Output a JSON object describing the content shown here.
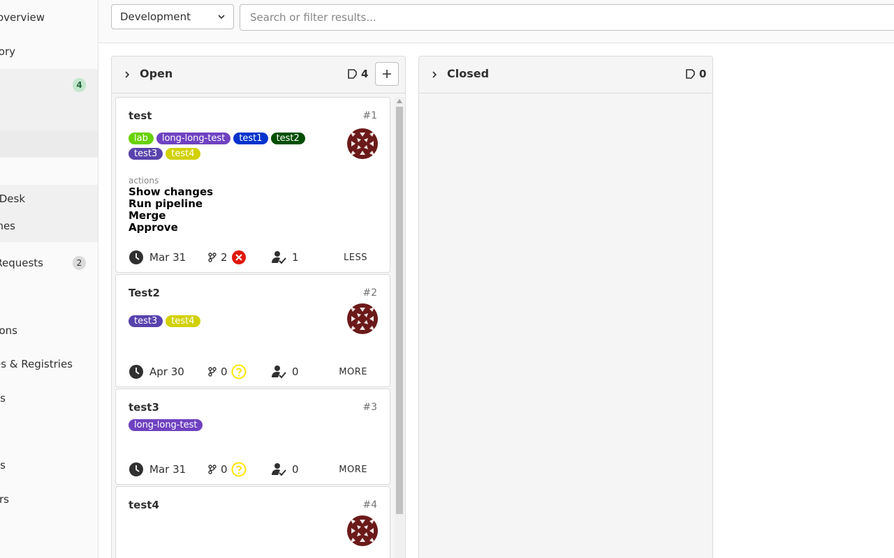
{
  "sidebar": {
    "items": [
      {
        "label": "overview"
      },
      {
        "label": "ory"
      },
      {
        "label": "Desk"
      },
      {
        "label": "nes"
      },
      {
        "label": "Requests"
      },
      {
        "label": "ons"
      },
      {
        "label": "es & Registries"
      },
      {
        "label": "s"
      },
      {
        "label": "s"
      },
      {
        "label": "rs"
      }
    ],
    "issues_count": "4",
    "mr_count": "2"
  },
  "filter": {
    "selected_board": "Development",
    "search_placeholder": "Search or filter results..."
  },
  "lists": {
    "open": {
      "title": "Open",
      "count": "4"
    },
    "closed": {
      "title": "Closed",
      "count": "0"
    }
  },
  "cards": [
    {
      "title": "test",
      "number": "#1",
      "labels": [
        {
          "text": "lab",
          "color": "#69d100"
        },
        {
          "text": "long-long-test",
          "color": "#6f42c1"
        },
        {
          "text": "test1",
          "color": "#0033cc"
        },
        {
          "text": "test2",
          "color": "#004e00"
        },
        {
          "text": "test3",
          "color": "#5843ad"
        },
        {
          "text": "test4",
          "color": "#d1d100"
        }
      ],
      "actions_heading": "actions",
      "actions": [
        "Show changes",
        "Run pipeline",
        "Merge",
        "Approve"
      ],
      "due": "Mar 31",
      "mr_count": "2",
      "mr_status": "failed",
      "assignees": "1",
      "toggle": "LESS"
    },
    {
      "title": "Test2",
      "number": "#2",
      "labels": [
        {
          "text": "test3",
          "color": "#5843ad"
        },
        {
          "text": "test4",
          "color": "#d1d100"
        }
      ],
      "due": "Apr 30",
      "mr_count": "0",
      "mr_status": "unknown",
      "assignees": "0",
      "toggle": "MORE"
    },
    {
      "title": "test3",
      "number": "#3",
      "labels": [
        {
          "text": "long-long-test",
          "color": "#6f42c1"
        }
      ],
      "due": "Mar 31",
      "mr_count": "0",
      "mr_status": "unknown",
      "assignees": "0",
      "toggle": "MORE"
    },
    {
      "title": "test4",
      "number": "#4",
      "labels": []
    }
  ],
  "icons": {
    "clock": "clock-icon",
    "merge_request": "merge-request-icon",
    "assignee": "assignee-icon",
    "issues": "issues-icon",
    "chevron": "chevron-right-icon"
  }
}
